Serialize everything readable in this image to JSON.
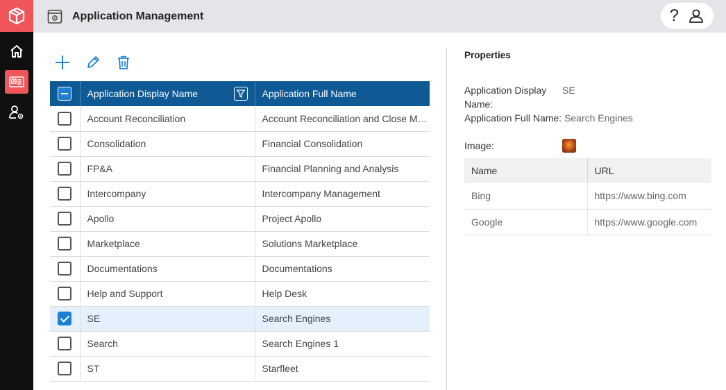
{
  "header": {
    "title": "Application Management",
    "help_label": "?"
  },
  "toolbar": {
    "add_icon": "plus-icon",
    "edit_icon": "pencil-icon",
    "delete_icon": "trash-icon"
  },
  "grid": {
    "columns": [
      "Application Display Name",
      "Application Full Name"
    ],
    "rows": [
      {
        "display": "Account Reconciliation",
        "full": "Account Reconciliation and Close Ma...",
        "checked": false
      },
      {
        "display": "Consolidation",
        "full": "Financial Consolidation",
        "checked": false
      },
      {
        "display": "FP&A",
        "full": "Financial Planning and Analysis",
        "checked": false
      },
      {
        "display": "Intercompany",
        "full": "Intercompany Management",
        "checked": false
      },
      {
        "display": "Apollo",
        "full": "Project Apollo",
        "checked": false
      },
      {
        "display": "Marketplace",
        "full": "Solutions Marketplace",
        "checked": false
      },
      {
        "display": "Documentations",
        "full": "Documentations",
        "checked": false
      },
      {
        "display": "Help and Support",
        "full": "Help Desk",
        "checked": false
      },
      {
        "display": "SE",
        "full": "Search Engines",
        "checked": true
      },
      {
        "display": "Search",
        "full": "Search Engines 1",
        "checked": false
      },
      {
        "display": "ST",
        "full": "Starfleet",
        "checked": false
      }
    ]
  },
  "properties": {
    "title": "Properties",
    "display_name_label": "Application Display Name:",
    "display_name_value": "SE",
    "full_name_label": "Application Full Name:",
    "full_name_value": "Search Engines",
    "image_label": "Image:",
    "url_table": {
      "columns": [
        "Name",
        "URL"
      ],
      "rows": [
        {
          "name": "Bing",
          "url": "https://www.bing.com"
        },
        {
          "name": "Google",
          "url": "https://www.google.com"
        }
      ]
    }
  },
  "colors": {
    "brand": "#f0555a",
    "grid_header": "#0f5a94",
    "selected_row": "#e4f1fc",
    "checkbox_checked": "#1d7fd0",
    "toolbar_icon": "#1d7fd0"
  }
}
